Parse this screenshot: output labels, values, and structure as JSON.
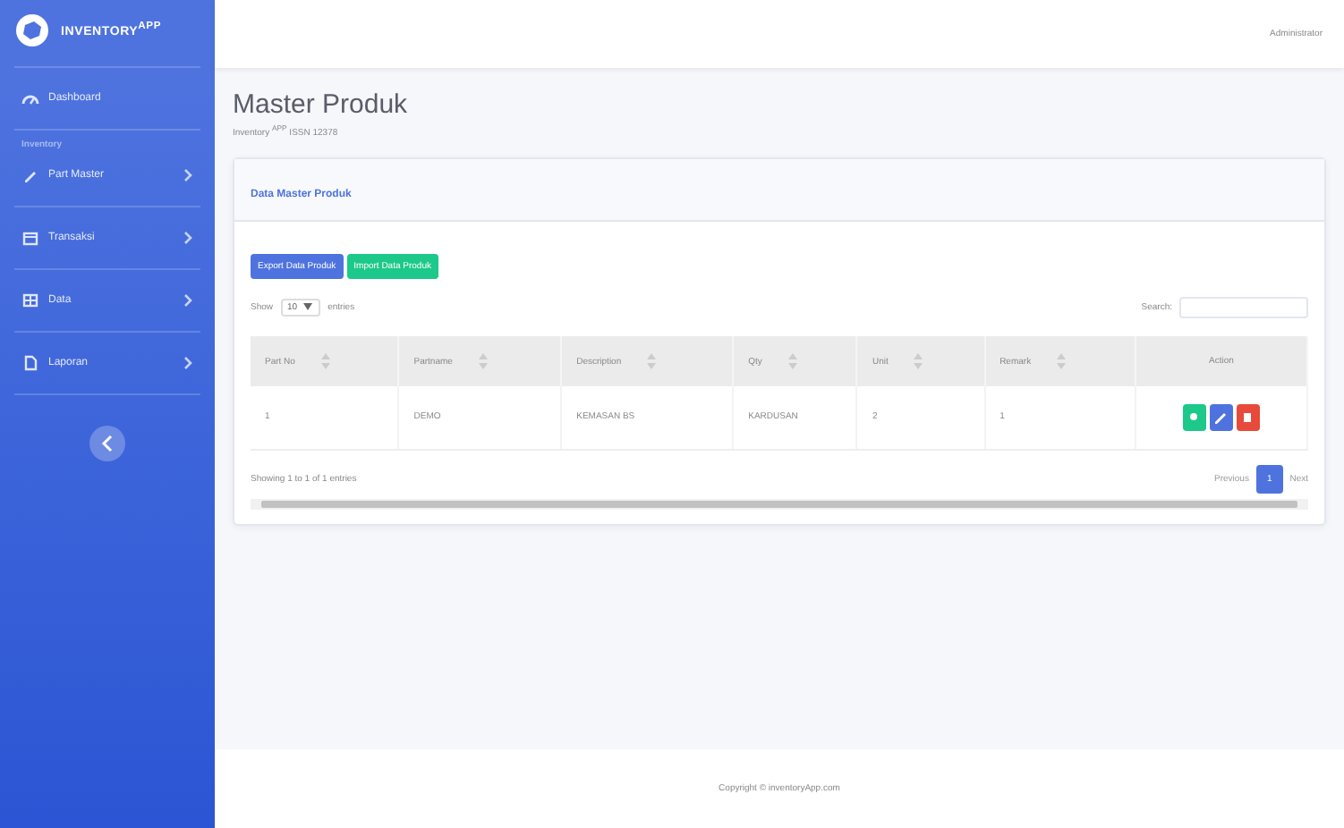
{
  "sidebar": {
    "brand": "INVENTORY$^{APP}$",
    "items": [
      {
        "kind": "link",
        "label": "Dashboard",
        "expandable": false
      },
      {
        "kind": "heading",
        "label": "Inventory"
      },
      {
        "kind": "link",
        "label": "Part Master",
        "expandable": true
      },
      {
        "kind": "link",
        "label": "Transaksi",
        "expandable": true
      },
      {
        "kind": "link",
        "label": "Data",
        "expandable": true
      },
      {
        "kind": "link",
        "label": "Laporan",
        "expandable": true
      }
    ]
  },
  "topbar": {
    "user": "Administrator"
  },
  "page": {
    "title": "Master Produk",
    "subtitle": "Inventory $^{APP}$ ISSN 12378"
  },
  "card": {
    "title": "Data Master Produk",
    "buttons": [
      {
        "label": "Export Data Produk",
        "kind": "primary"
      },
      {
        "label": "Import Data Produk",
        "kind": "success"
      }
    ],
    "length": {
      "before": "Show",
      "value": "10",
      "after": "entries"
    },
    "search_label": "Search:",
    "table": {
      "columns": [
        "Part No",
        "Partname",
        "Description",
        "Qty",
        "Unit",
        "Remark",
        "Action"
      ],
      "rows": [
        {
          "cells": [
            "1",
            "DEMO",
            "KEMASAN BS",
            "KARDUSAN",
            "2",
            "1"
          ]
        }
      ]
    },
    "info": "Showing 1 to 1 of 1 entries",
    "pagination": {
      "previous": "Previous",
      "next": "Next",
      "pages": [
        {
          "label": "1",
          "selected": true
        }
      ]
    }
  },
  "footer": "Copyright © inventoryApp.com"
}
